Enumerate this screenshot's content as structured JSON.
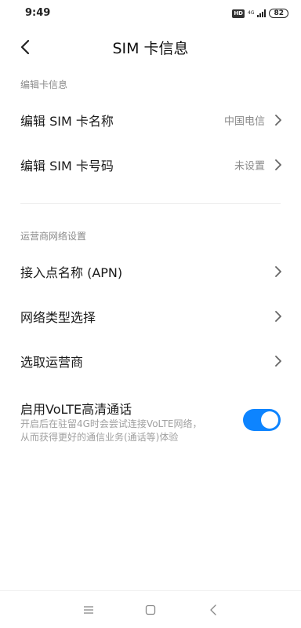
{
  "status_bar": {
    "time": "9:49",
    "hd": "HD",
    "network": "4G",
    "battery": "82"
  },
  "header": {
    "title": "SIM 卡信息",
    "back_icon": "chevron-left-icon"
  },
  "section_edit": {
    "title": "编辑卡信息",
    "items": [
      {
        "label": "编辑 SIM 卡名称",
        "value": "中国电信"
      },
      {
        "label": "编辑 SIM 卡号码",
        "value": "未设置"
      }
    ]
  },
  "section_carrier": {
    "title": "运营商网络设置",
    "items": [
      {
        "label": "接入点名称 (APN)"
      },
      {
        "label": "网络类型选择"
      },
      {
        "label": "选取运营商"
      }
    ]
  },
  "volte": {
    "title": "启用VoLTE高清通话",
    "description_line1": "开启后在驻留4G时会尝试连接VoLTE网络，",
    "description_line2": "从而获得更好的通信业务(通话等)体验",
    "enabled": true
  },
  "colors": {
    "accent": "#0d84ff",
    "secondary_text": "#8a8a8a"
  },
  "nav_bar": {
    "icons": [
      "menu-icon",
      "home-square-icon",
      "back-triangle-icon"
    ]
  }
}
